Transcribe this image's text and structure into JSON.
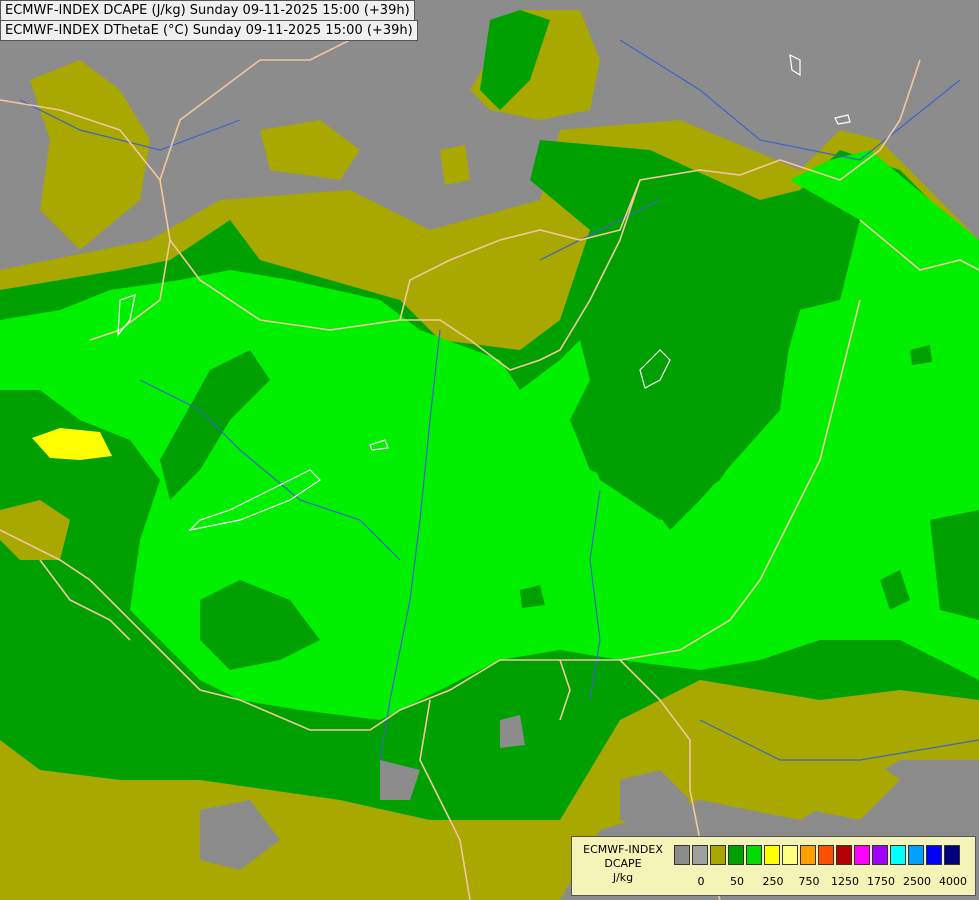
{
  "titles": {
    "line1": "ECMWF-INDEX DCAPE (J/kg) Sunday 09-11-2025 15:00 (+39h)",
    "line2": "ECMWF-INDEX DThetaE (°C) Sunday 09-11-2025 15:00 (+39h)"
  },
  "legend": {
    "title_line1": "ECMWF-INDEX",
    "title_line2": "DCAPE",
    "title_line3": "J/kg",
    "colors": [
      "#8c8c8c",
      "#a0a0a0",
      "#a8a800",
      "#00a000",
      "#00dc00",
      "#ffff00",
      "#ffff80",
      "#ffa000",
      "#ff5000",
      "#b40000",
      "#ff00ff",
      "#a000ff",
      "#00ffff",
      "#00a0ff",
      "#0000ff",
      "#000080"
    ],
    "tick_labels": [
      "0",
      "50",
      "250",
      "750",
      "1250",
      "1750",
      "2500",
      "4000"
    ]
  },
  "map_colors": {
    "no_data_gray": "#8c8c8c",
    "olive": "#a8a800",
    "dark_green": "#00a000",
    "bright_green": "#00f000",
    "yellow": "#ffff00",
    "borders": "#f0c8a0",
    "rivers": "#3c64c8",
    "lakes_outline": "#ffffff"
  }
}
